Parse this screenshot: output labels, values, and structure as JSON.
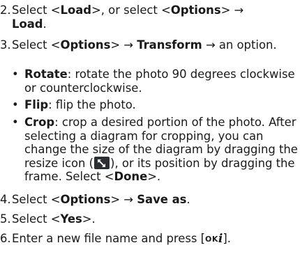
{
  "steps": {
    "s2": {
      "num": "2.",
      "p1": "Select <",
      "b1": "Load",
      "p2": ">, or select <",
      "b2": "Options",
      "p3": "> → ",
      "b3": "Load",
      "p4": "."
    },
    "s3": {
      "num": "3.",
      "p1": "Select <",
      "b1": "Options",
      "p2": "> → ",
      "b2": "Transform",
      "p3": " → an option.",
      "bullets": {
        "rotate": {
          "term": "Rotate",
          "text": ": rotate the photo 90 degrees clockwise or counterclockwise."
        },
        "flip": {
          "term": "Flip",
          "text": ": flip the photo."
        },
        "crop": {
          "term": "Crop",
          "text1": ": crop a desired portion of the photo. After selecting a diagram for cropping, you can change the size of the diagram by dragging the resize icon (",
          "icon": "resize-icon",
          "text2": "), or its position by dragging the frame. Select <",
          "bold": "Done",
          "text3": ">."
        }
      }
    },
    "s4": {
      "num": "4.",
      "p1": "Select <",
      "b1": "Options",
      "p2": "> → ",
      "b2": "Save as",
      "p3": "."
    },
    "s5": {
      "num": "5.",
      "p1": "Select <",
      "b1": "Yes",
      "p2": ">."
    },
    "s6": {
      "num": "6.",
      "p1": "Enter a new file name and press [",
      "key": "OK",
      "keyIcon": "i",
      "p2": "]."
    }
  },
  "bullet_char": "•"
}
